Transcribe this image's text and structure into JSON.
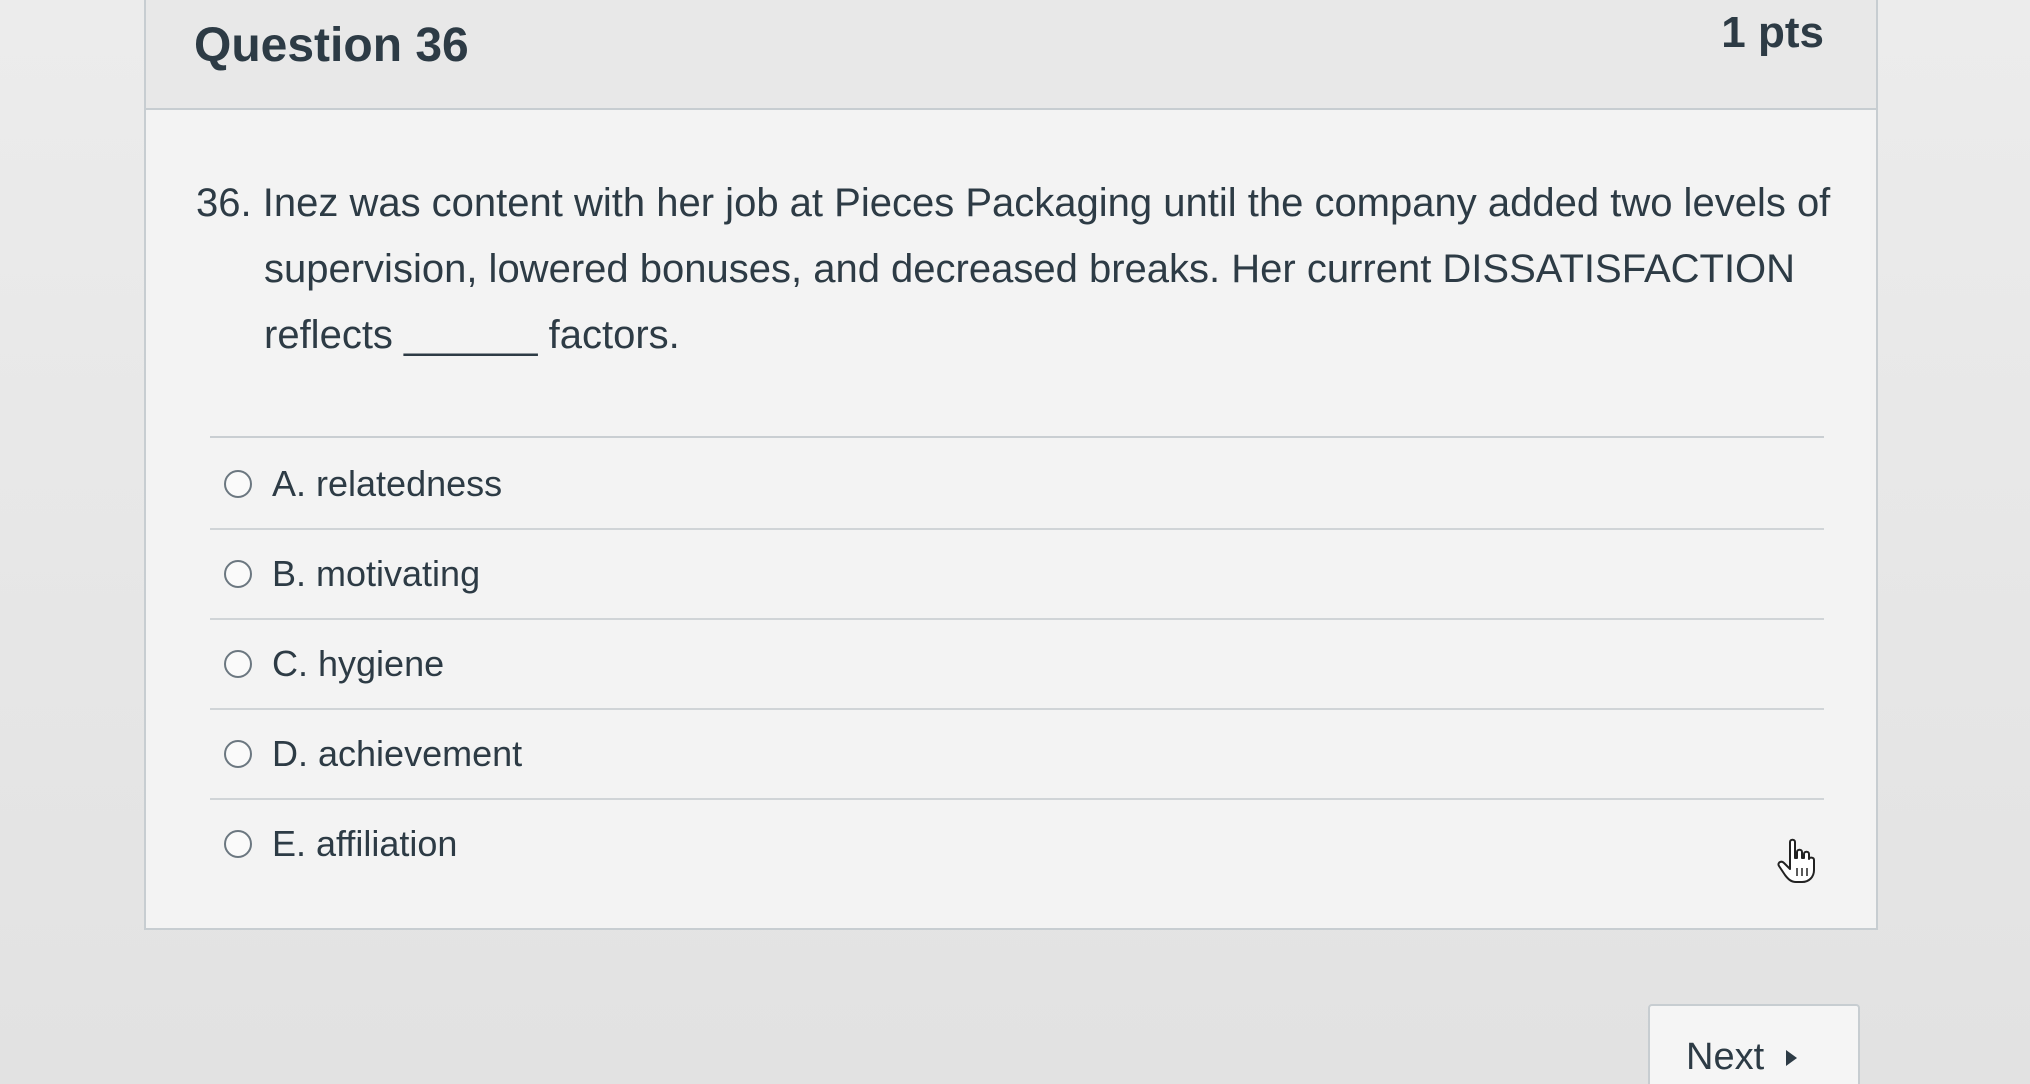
{
  "question": {
    "title": "Question 36",
    "points": "1 pts",
    "text": "36. Inez was content with her job at Pieces Packaging until the company added two levels of supervision, lowered bonuses, and decreased breaks. Her current DISSATISFACTION reflects ______ factors."
  },
  "answers": [
    {
      "label": "A. relatedness"
    },
    {
      "label": "B. motivating"
    },
    {
      "label": "C. hygiene"
    },
    {
      "label": "D. achievement"
    },
    {
      "label": "E. affiliation"
    }
  ],
  "navigation": {
    "next_label": "Next"
  },
  "icons": {
    "cursor": "hand-pointer-icon",
    "next": "triangle-right-icon",
    "radio": "radio-unselected-icon"
  }
}
